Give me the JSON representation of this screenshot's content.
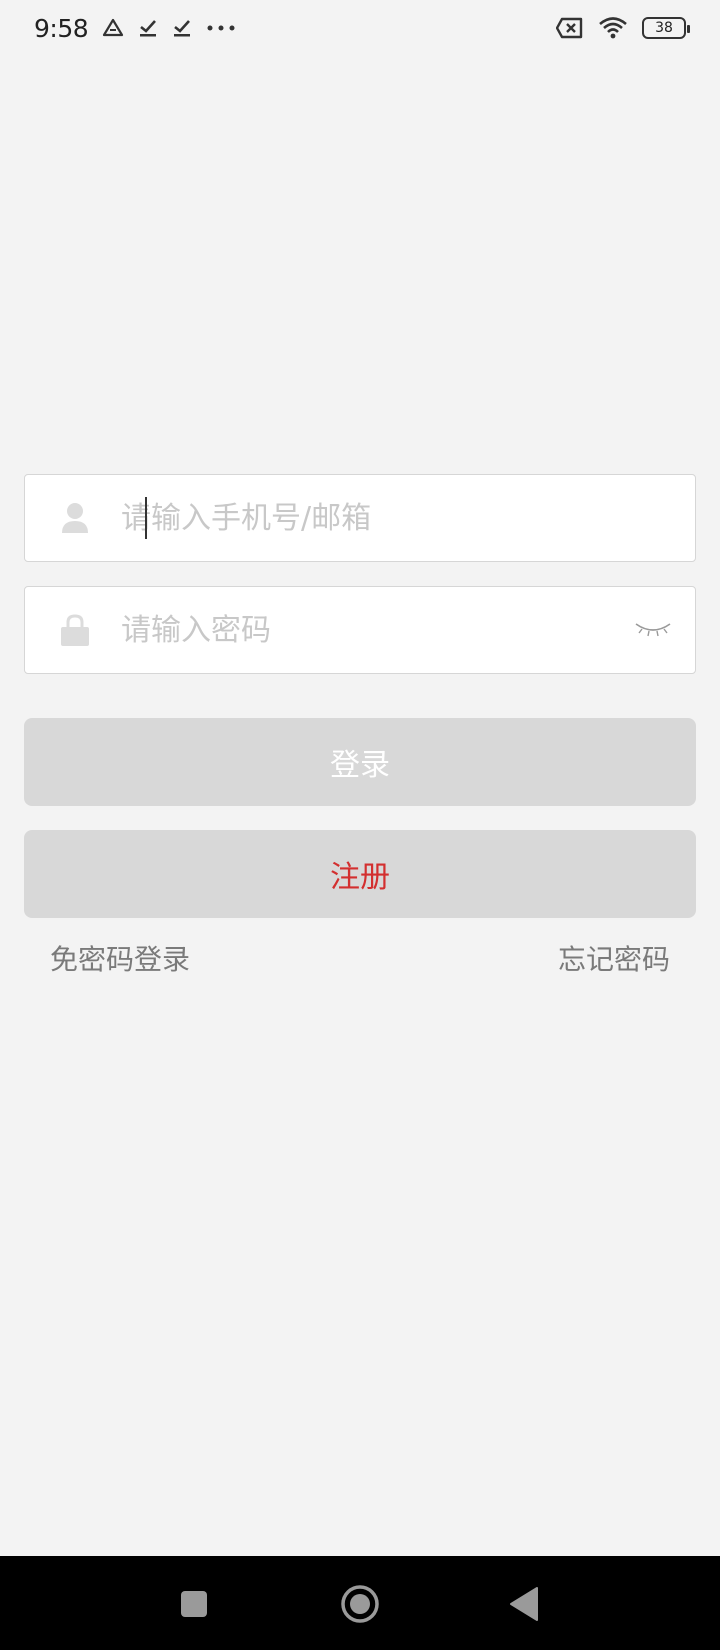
{
  "status_bar": {
    "time": "9:58",
    "battery_level": "38",
    "icons": [
      "drive-icon",
      "check-icon",
      "check-icon",
      "more-dots-icon",
      "no-sim-icon",
      "wifi-icon",
      "battery-icon"
    ]
  },
  "login_form": {
    "username_placeholder": "请输入手机号/邮箱",
    "password_placeholder": "请输入密码",
    "login_label": "登录",
    "register_label": "注册",
    "sms_login_label": "免密码登录",
    "forgot_password_label": "忘记密码"
  },
  "colors": {
    "background": "#f3f3f3",
    "button_bg": "#d8d8d8",
    "register_text": "#d32f2f",
    "link_text": "#7a7a7a"
  },
  "nav_bar": {
    "icons": [
      "recent-apps-icon",
      "home-icon",
      "back-icon"
    ]
  }
}
